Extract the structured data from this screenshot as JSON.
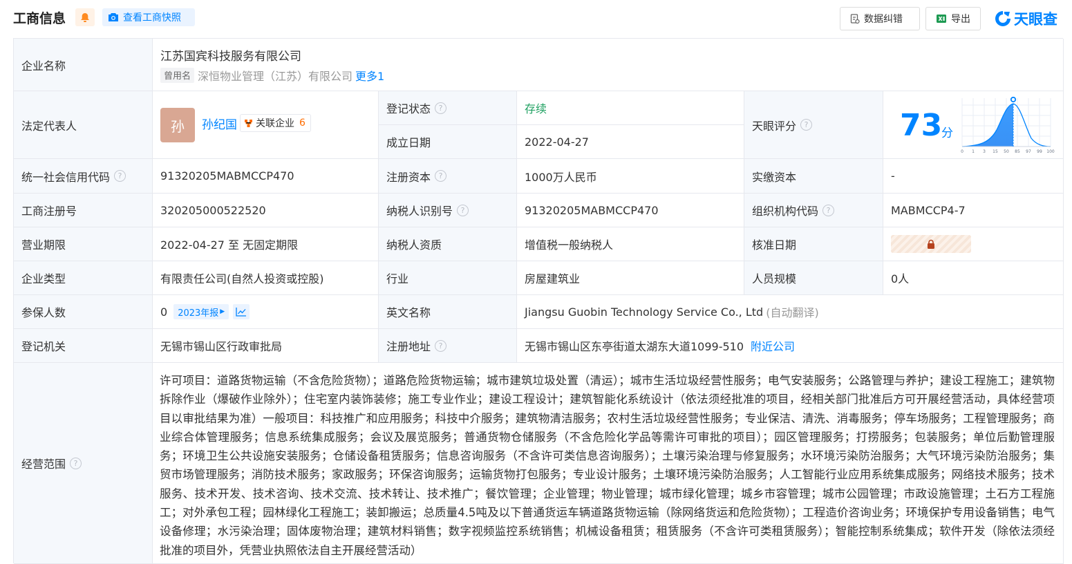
{
  "header": {
    "title": "工商信息",
    "snapshot_label": "查看工商快照",
    "correct_label": "数据纠错",
    "export_label": "导出",
    "logo_text": "天眼查",
    "icons": [
      "bell-icon",
      "camera-icon",
      "correct-doc-icon",
      "excel-icon",
      "tianyancha-logo-icon"
    ],
    "accent": "#0084ff"
  },
  "company": {
    "label": "企业名称",
    "name": "江苏国宾科技服务有限公司",
    "used_name_tag": "曾用名",
    "used_name": "深恒物业管理（江苏）有限公司",
    "more_link": "更多1"
  },
  "legal_rep": {
    "label": "法定代表人",
    "avatar_char": "孙",
    "name": "孙纪国",
    "assoc_label": "关联企业",
    "assoc_count": "6"
  },
  "reg_status": {
    "label": "登记状态",
    "value": "存续"
  },
  "est_date": {
    "label": "成立日期",
    "value": "2022-04-27"
  },
  "tianyan_score": {
    "label": "天眼评分",
    "score": "73",
    "unit": "分",
    "axis_ticks": [
      "0",
      "1",
      "3",
      "15",
      "50",
      "85",
      "97",
      "99",
      "100"
    ]
  },
  "credit_code": {
    "label": "统一社会信用代码",
    "value": "91320205MABMCCP470"
  },
  "reg_capital": {
    "label": "注册资本",
    "value": "1000万人民币"
  },
  "paid_capital": {
    "label": "实缴资本",
    "value": "-"
  },
  "biz_reg_no": {
    "label": "工商注册号",
    "value": "320205000522520"
  },
  "tax_id": {
    "label": "纳税人识别号",
    "value": "91320205MABMCCP470"
  },
  "org_code": {
    "label": "组织机构代码",
    "value": "MABMCCP4-7"
  },
  "biz_term": {
    "label": "营业期限",
    "value": "2022-04-27 至 无固定期限"
  },
  "taxpayer_qual": {
    "label": "纳税人资质",
    "value": "增值税一般纳税人"
  },
  "approval_date": {
    "label": "核准日期",
    "locked": true
  },
  "company_type": {
    "label": "企业类型",
    "value": "有限责任公司(自然人投资或控股)"
  },
  "industry": {
    "label": "行业",
    "value": "房屋建筑业"
  },
  "staff_size": {
    "label": "人员规模",
    "value": "0人"
  },
  "insured": {
    "label": "参保人数",
    "value": "0",
    "year_tag": "2023年报"
  },
  "english_name": {
    "label": "英文名称",
    "value": "Jiangsu Guobin Technology Service Co., Ltd",
    "note": "(自动翻译)"
  },
  "reg_authority": {
    "label": "登记机关",
    "value": "无锡市锡山区行政审批局"
  },
  "reg_address": {
    "label": "注册地址",
    "value": "无锡市锡山区东亭街道太湖东大道1099-510",
    "link": "附近公司"
  },
  "scope": {
    "label": "经营范围",
    "text": "许可项目：道路货物运输（不含危险货物）；道路危险货物运输；城市建筑垃圾处置（清运）；城市生活垃圾经营性服务；电气安装服务；公路管理与养护；建设工程施工；建筑物拆除作业（爆破作业除外）；住宅室内装饰装修；施工专业作业；建设工程设计；建筑智能化系统设计（依法须经批准的项目，经相关部门批准后方可开展经营活动，具体经营项目以审批结果为准）一般项目：科技推广和应用服务；科技中介服务；建筑物清洁服务；农村生活垃圾经营性服务；专业保洁、清洗、消毒服务；停车场服务；工程管理服务；商业综合体管理服务；信息系统集成服务；会议及展览服务；普通货物仓储服务（不含危险化学品等需许可审批的项目）；园区管理服务；打捞服务；包装服务；单位后勤管理服务；环境卫生公共设施安装服务；仓储设备租赁服务；信息咨询服务（不含许可类信息咨询服务）；土壤污染治理与修复服务；水环境污染防治服务；大气环境污染防治服务；集贸市场管理服务；消防技术服务；家政服务；环保咨询服务；运输货物打包服务；专业设计服务；土壤环境污染防治服务；人工智能行业应用系统集成服务；网络技术服务；技术服务、技术开发、技术咨询、技术交流、技术转让、技术推广；餐饮管理；企业管理；物业管理；城市绿化管理；城乡市容管理；城市公园管理；市政设施管理；土石方工程施工；对外承包工程；园林绿化工程施工；装卸搬运；总质量4.5吨及以下普通货运车辆道路货物运输（除网络货运和危险货物）；工程造价咨询业务；环境保护专用设备销售；电气设备修理；水污染治理；固体废物治理；建筑材料销售；数字视频监控系统销售；机械设备租赁；租赁服务（不含许可类租赁服务）；智能控制系统集成；软件开发（除依法须经批准的项目外，凭营业执照依法自主开展经营活动）"
  }
}
